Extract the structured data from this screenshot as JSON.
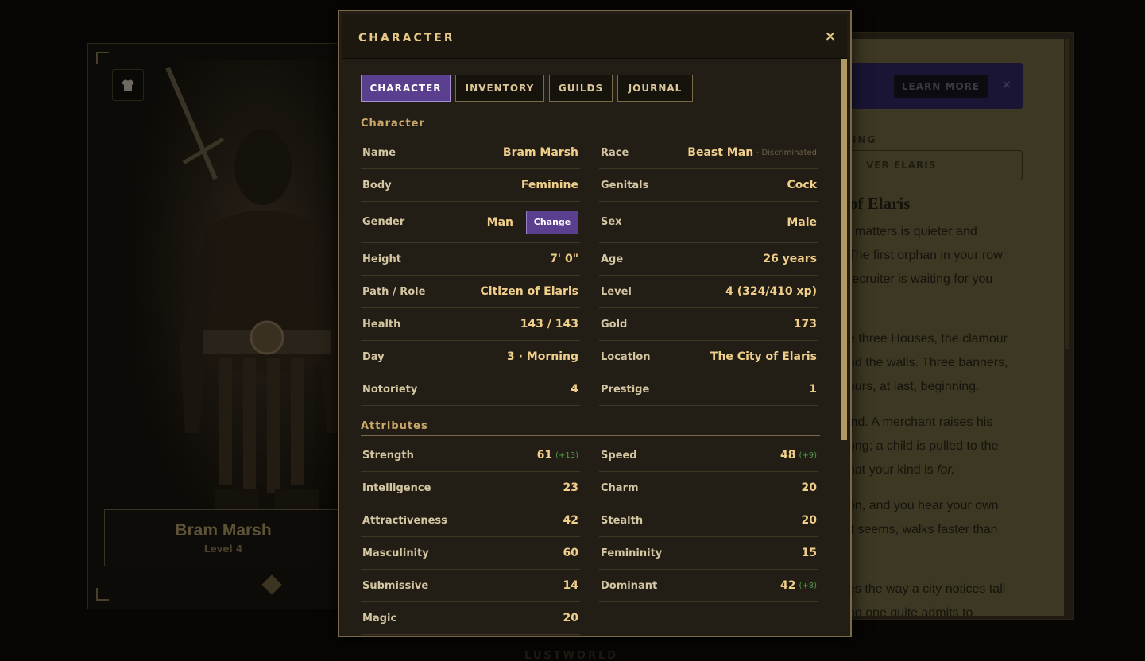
{
  "background": {
    "portrait": {
      "name": "Bram Marsh",
      "level": "Level 4"
    },
    "story": {
      "banner_button": "LEARN MORE",
      "banner_close": "×",
      "label_small": "ING",
      "box_text": "VER ELARIS",
      "heading": "of Elaris",
      "lines": [
        "t matters is quieter and",
        "The first orphan in your row",
        "recruiter is waiting for you",
        "e three Houses, the clamour",
        "nd the walls. Three banners,",
        "ours, at last, beginning.",
        "ind. A merchant raises his",
        "ong; a child is pulled to the",
        "hat your kind is",
        "for.",
        "on, and you hear your own",
        "it seems, walks faster than",
        "es the way a city notices tall",
        "no one quite admits to"
      ]
    },
    "footer_brand": "LUSTWORLD"
  },
  "modal": {
    "title": "CHARACTER",
    "close": "×",
    "tabs": [
      {
        "label": "CHARACTER",
        "active": true
      },
      {
        "label": "INVENTORY",
        "active": false
      },
      {
        "label": "GUILDS",
        "active": false
      },
      {
        "label": "JOURNAL",
        "active": false
      }
    ],
    "character_section": "Character",
    "fields": {
      "name": {
        "label": "Name",
        "value": "Bram Marsh"
      },
      "race": {
        "label": "Race",
        "value": "Beast Man",
        "note": "· Discriminated"
      },
      "body": {
        "label": "Body",
        "value": "Feminine"
      },
      "genitals": {
        "label": "Genitals",
        "value": "Cock"
      },
      "gender": {
        "label": "Gender",
        "value": "Man",
        "button": "Change"
      },
      "sex": {
        "label": "Sex",
        "value": "Male"
      },
      "height": {
        "label": "Height",
        "value": "7' 0\""
      },
      "age": {
        "label": "Age",
        "value": "26 years"
      },
      "path": {
        "label": "Path / Role",
        "value": "Citizen of Elaris"
      },
      "level": {
        "label": "Level",
        "value": "4 (324/410 xp)"
      },
      "health": {
        "label": "Health",
        "value": "143 / 143"
      },
      "gold": {
        "label": "Gold",
        "value": "173"
      },
      "day": {
        "label": "Day",
        "value": "3 · Morning"
      },
      "location": {
        "label": "Location",
        "value": "The City of Elaris"
      },
      "notoriety": {
        "label": "Notoriety",
        "value": "4"
      },
      "prestige": {
        "label": "Prestige",
        "value": "1"
      }
    },
    "attributes_section": "Attributes",
    "attributes": {
      "strength": {
        "label": "Strength",
        "value": "61",
        "bonus": "(+13)"
      },
      "speed": {
        "label": "Speed",
        "value": "48",
        "bonus": "(+9)"
      },
      "intelligence": {
        "label": "Intelligence",
        "value": "23"
      },
      "charm": {
        "label": "Charm",
        "value": "20"
      },
      "attractiveness": {
        "label": "Attractiveness",
        "value": "42"
      },
      "stealth": {
        "label": "Stealth",
        "value": "20"
      },
      "masculinity": {
        "label": "Masculinity",
        "value": "60"
      },
      "femininity": {
        "label": "Femininity",
        "value": "15"
      },
      "submissive": {
        "label": "Submissive",
        "value": "14"
      },
      "dominant": {
        "label": "Dominant",
        "value": "42",
        "bonus": "(+8)"
      },
      "magic": {
        "label": "Magic",
        "value": "20"
      }
    }
  }
}
